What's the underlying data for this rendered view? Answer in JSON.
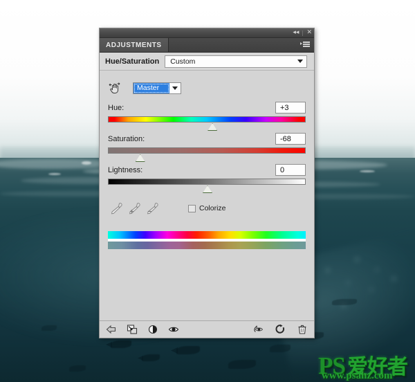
{
  "window": {
    "titlebar": {
      "collapse_icon": "double-chevron-left-icon",
      "collapse_glyph": "◂◂",
      "close_icon": "close-icon",
      "close_glyph": "✕"
    },
    "tab_label": "ADJUSTMENTS",
    "flyout_icon": "panel-menu-icon"
  },
  "subheader": {
    "title": "Hue/Saturation",
    "preset_value": "Custom",
    "preset_caret_icon": "chevron-down-icon"
  },
  "controls": {
    "on_image_tool_icon": "on-image-adjustment-hand-icon",
    "channel_value": "Master",
    "channel_caret_icon": "chevron-down-icon"
  },
  "sliders": [
    {
      "label": "Hue:",
      "value": "+3",
      "name": "hue",
      "position_pct": 52.5
    },
    {
      "label": "Saturation:",
      "value": "-68",
      "name": "saturation",
      "position_pct": 16.0
    },
    {
      "label": "Lightness:",
      "value": "0",
      "name": "lightness",
      "position_pct": 50.0
    }
  ],
  "tools": {
    "eyedropper_icon": "eyedropper-icon",
    "eyedropper_plus_icon": "eyedropper-plus-icon",
    "eyedropper_minus_icon": "eyedropper-minus-icon",
    "colorize_label": "Colorize",
    "colorize_checked": false
  },
  "footer": {
    "left": [
      {
        "name": "return-to-adjustment-list-button",
        "icon": "left-arrow-icon"
      },
      {
        "name": "clip-to-layer-button",
        "icon": "clip-to-layer-icon"
      },
      {
        "name": "toggle-grayscale-preview-button",
        "icon": "half-circle-icon"
      },
      {
        "name": "toggle-layer-visibility-button",
        "icon": "eye-icon"
      }
    ],
    "right": [
      {
        "name": "preview-previous-state-button",
        "icon": "eye-previous-state-icon"
      },
      {
        "name": "reset-adjustment-button",
        "icon": "reset-circular-arrow-icon"
      },
      {
        "name": "delete-adjustment-layer-button",
        "icon": "trash-icon"
      }
    ]
  },
  "watermark": {
    "brand": "PS",
    "brand_cn": "爱好者",
    "url": "www.psahz.com"
  },
  "colors": {
    "panel_bg": "#d4d4d4",
    "titlebar": "#4c4c4c",
    "selection_blue": "#2d7fe0",
    "thumb_outline": "#4c6b3c",
    "watermark_green": "#1d8f2a"
  }
}
